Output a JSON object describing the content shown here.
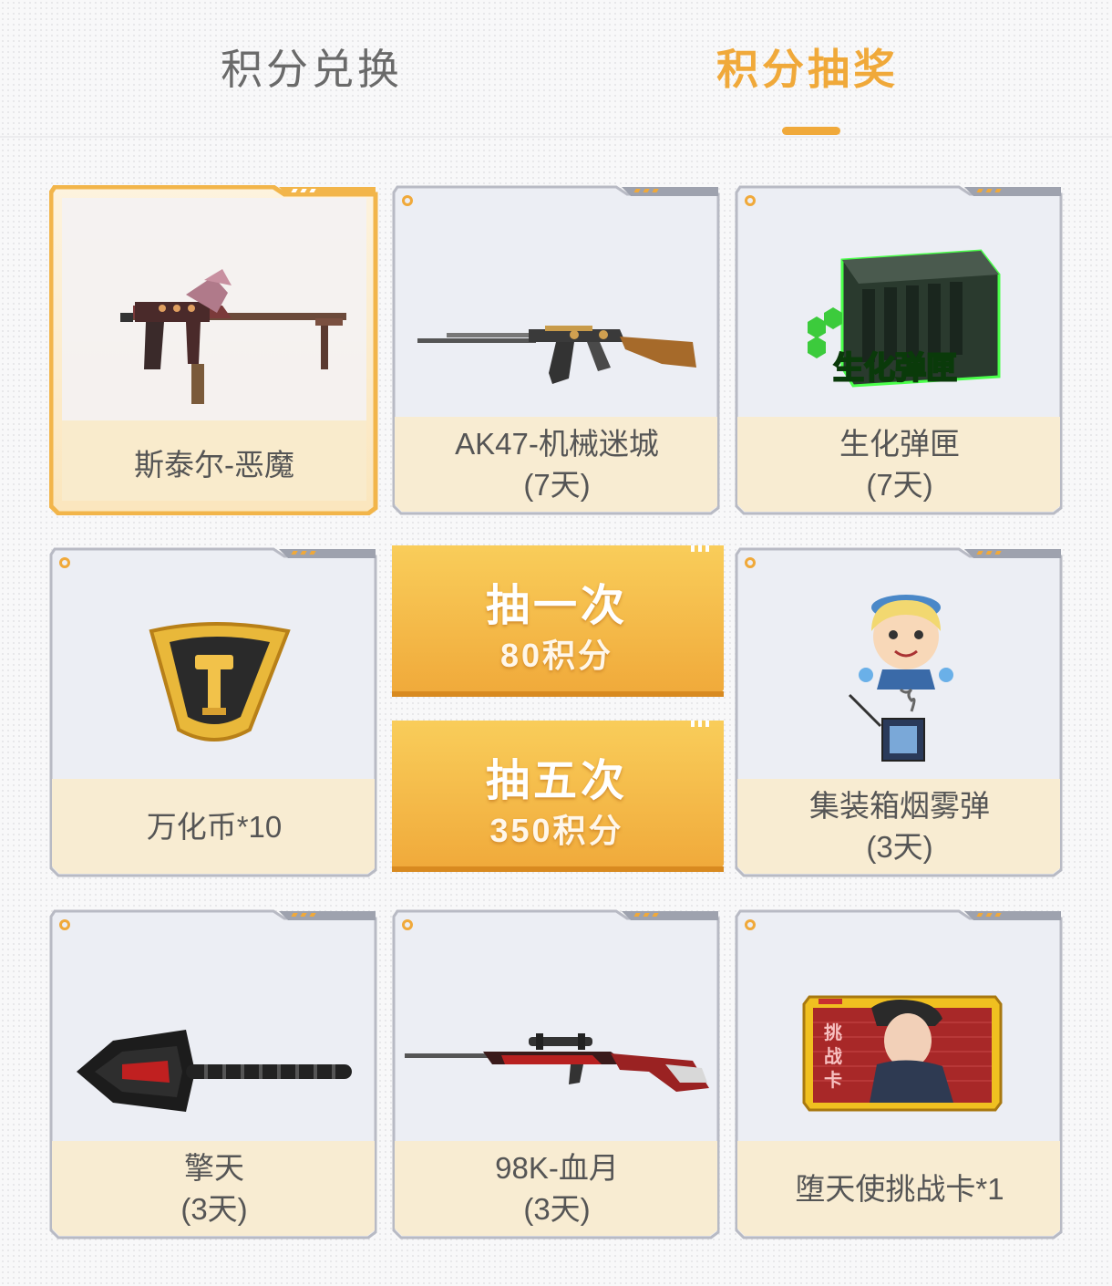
{
  "tabs": {
    "exchange": "积分兑换",
    "lottery": "积分抽奖",
    "active": "lottery"
  },
  "colors": {
    "accent": "#f0a93a",
    "inactive_text": "#6a6a6a",
    "card_label_bg": "#f8ecd2",
    "card_image_bg": "#eef0f6"
  },
  "prizes": [
    {
      "name": "斯泰尔-恶魔",
      "duration": "",
      "icon": "smg-icon",
      "selected": true
    },
    {
      "name": "AK47-机械迷城",
      "duration": "(7天)",
      "icon": "rifle-icon",
      "selected": false
    },
    {
      "name": "生化弹匣",
      "duration": "(7天)",
      "icon": "ammo-box-icon",
      "selected": false
    },
    {
      "name": "万化币*10",
      "duration": "",
      "icon": "coin-badge-icon",
      "selected": false
    },
    {
      "name": "集装箱烟雾弹",
      "duration": "(3天)",
      "icon": "character-grenade-icon",
      "selected": false
    },
    {
      "name": "擎天",
      "duration": "(3天)",
      "icon": "melee-weapon-icon",
      "selected": false
    },
    {
      "name": "98K-血月",
      "duration": "(3天)",
      "icon": "sniper-rifle-icon",
      "selected": false
    },
    {
      "name": "堕天使挑战卡*1",
      "duration": "",
      "icon": "challenge-card-icon",
      "selected": false
    }
  ],
  "ammo_box_text": "生化弹匣",
  "challenge_card_text": "挑战卡",
  "draw_once": {
    "title": "抽一次",
    "cost": "80积分"
  },
  "draw_five": {
    "title": "抽五次",
    "cost": "350积分"
  }
}
